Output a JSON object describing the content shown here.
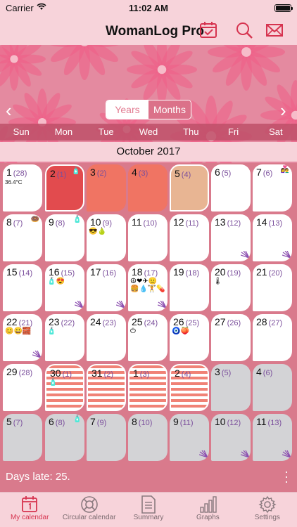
{
  "status": {
    "carrier": "Carrier",
    "time": "11:02 AM"
  },
  "header": {
    "title": "WomanLog Pro"
  },
  "view_toggle": {
    "years": "Years",
    "months": "Months"
  },
  "weekdays": [
    "Sun",
    "Mon",
    "Tue",
    "Wed",
    "Thu",
    "Fri",
    "Sat"
  ],
  "month_title": "October 2017",
  "days": [
    {
      "d": "1",
      "c": "(28)",
      "note": "36.4°C"
    },
    {
      "d": "2",
      "c": "(1)",
      "style": "red",
      "badge": "🧴"
    },
    {
      "d": "3",
      "c": "(2)",
      "style": "salmon"
    },
    {
      "d": "4",
      "c": "(3)",
      "style": "salmon"
    },
    {
      "d": "5",
      "c": "(4)",
      "style": "peach"
    },
    {
      "d": "6",
      "c": "(5)"
    },
    {
      "d": "7",
      "c": "(6)",
      "badge": "👩‍❤️‍👨"
    },
    {
      "d": "8",
      "c": "(7)",
      "badge": "🍩"
    },
    {
      "d": "9",
      "c": "(8)",
      "badge": "🧴"
    },
    {
      "d": "10",
      "c": "(9)",
      "icons": "😎🍐"
    },
    {
      "d": "11",
      "c": "(10)"
    },
    {
      "d": "12",
      "c": "(11)"
    },
    {
      "d": "13",
      "c": "(12)",
      "fan": true
    },
    {
      "d": "14",
      "c": "(13)",
      "fan": true
    },
    {
      "d": "15",
      "c": "(14)"
    },
    {
      "d": "16",
      "c": "(15)",
      "icons": "🧴😍",
      "fan": true
    },
    {
      "d": "17",
      "c": "(16)",
      "fan": true
    },
    {
      "d": "18",
      "c": "(17)",
      "icons": "☮❤✈😐🍔💧🏋💊",
      "fan": true
    },
    {
      "d": "19",
      "c": "(18)"
    },
    {
      "d": "20",
      "c": "(19)",
      "icons": "🌡"
    },
    {
      "d": "21",
      "c": "(20)"
    },
    {
      "d": "22",
      "c": "(21)",
      "icons": "😊😀🧱",
      "fan": true
    },
    {
      "d": "23",
      "c": "(22)",
      "icons": "🧴"
    },
    {
      "d": "24",
      "c": "(23)"
    },
    {
      "d": "25",
      "c": "(24)",
      "icons": "⏻"
    },
    {
      "d": "26",
      "c": "(25)",
      "icons": "🧿🍑"
    },
    {
      "d": "27",
      "c": "(26)"
    },
    {
      "d": "28",
      "c": "(27)"
    },
    {
      "d": "29",
      "c": "(28)"
    },
    {
      "d": "30",
      "c": "(1)",
      "style": "striped",
      "icons": "🧴"
    },
    {
      "d": "31",
      "c": "(2)",
      "style": "striped"
    },
    {
      "d": "1",
      "c": "(3)",
      "style": "striped"
    },
    {
      "d": "2",
      "c": "(4)",
      "style": "striped"
    },
    {
      "d": "3",
      "c": "(5)",
      "style": "grey"
    },
    {
      "d": "4",
      "c": "(6)",
      "style": "grey"
    },
    {
      "d": "5",
      "c": "(7)",
      "style": "grey"
    },
    {
      "d": "6",
      "c": "(8)",
      "style": "grey",
      "badge": "🧴"
    },
    {
      "d": "7",
      "c": "(9)",
      "style": "grey"
    },
    {
      "d": "8",
      "c": "(10)",
      "style": "grey"
    },
    {
      "d": "9",
      "c": "(11)",
      "style": "grey",
      "fan": true
    },
    {
      "d": "10",
      "c": "(12)",
      "style": "grey",
      "fan": true
    },
    {
      "d": "11",
      "c": "(13)",
      "style": "grey",
      "fan": true
    }
  ],
  "footer": {
    "days_late": "Days late: 25."
  },
  "tabs": [
    {
      "label": "My calendar",
      "icon": "calendar-icon",
      "active": true
    },
    {
      "label": "Circular calendar",
      "icon": "lifebuoy-icon"
    },
    {
      "label": "Summary",
      "icon": "document-icon"
    },
    {
      "label": "Graphs",
      "icon": "bar-graph-icon"
    },
    {
      "label": "Settings",
      "icon": "gear-icon"
    }
  ],
  "colors": {
    "accent": "#d6334f",
    "period": "#e24b4e",
    "background": "#d97a8c"
  }
}
